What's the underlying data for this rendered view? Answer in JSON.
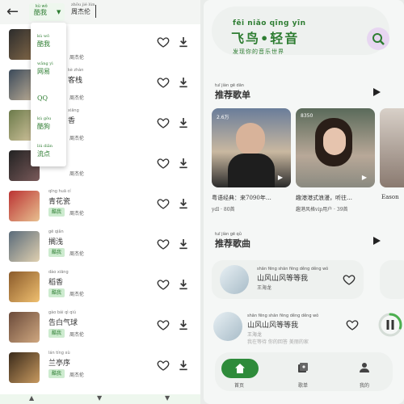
{
  "left": {
    "source_select": {
      "label": "酷我",
      "pinyin": "kù wǒ"
    },
    "search_value": {
      "text": "周杰伦",
      "pinyin": "zhōu jié lún"
    },
    "dropdown": [
      {
        "label": "酷我",
        "pinyin": "kù wǒ"
      },
      {
        "label": "网易",
        "pinyin": "wǎng yì"
      },
      {
        "label": "QQ",
        "pinyin": ""
      },
      {
        "label": "酷狗",
        "pinyin": "kù gǒu"
      },
      {
        "label": "流点",
        "pinyin": "liú diǎn"
      }
    ],
    "rows": [
      {
        "title": "",
        "pinyin": "",
        "badge": "",
        "artist": "周杰伦",
        "artist_pinyin": "zhōu jié lún"
      },
      {
        "title": "客栈",
        "pinyin": "kè zhàn",
        "badge": "",
        "artist": "周杰伦",
        "artist_pinyin": "zhōu jié lún"
      },
      {
        "title": "香",
        "pinyin": "xiāng",
        "badge": "",
        "artist": "周杰伦",
        "artist_pinyin": "zhōu jié lún"
      },
      {
        "title": "",
        "pinyin": "",
        "badge": "",
        "artist": "周杰伦",
        "artist_pinyin": "zhōu jié lún"
      },
      {
        "title": "青花瓷",
        "pinyin": "qīng huā cí",
        "badge": "酷我",
        "artist": "周杰伦",
        "artist_pinyin": "zhōu jié lún"
      },
      {
        "title": "搁浅",
        "pinyin": "gē qiǎn",
        "badge": "酷我",
        "artist": "周杰伦",
        "artist_pinyin": "zhōu jié lún"
      },
      {
        "title": "稻香",
        "pinyin": "dào xiāng",
        "badge": "酷我",
        "artist": "周杰伦",
        "artist_pinyin": "zhōu jié lún"
      },
      {
        "title": "告白气球",
        "pinyin": "gào bái qì qiú",
        "badge": "酷我",
        "artist": "周杰伦",
        "artist_pinyin": "zhōu jié lún"
      },
      {
        "title": "兰亭序",
        "pinyin": "lán tíng xù",
        "badge": "酷我",
        "artist": "周杰伦",
        "artist_pinyin": "zhōu jié lún"
      }
    ]
  },
  "right": {
    "logo": {
      "pinyin": "fēi niǎo qīng yīn",
      "text": "飞鸟•轻音",
      "sub": "发现你的音乐世界"
    },
    "playlist_section": {
      "title": "推荐歌单",
      "pinyin": "tuī jiàn gē dān"
    },
    "playlists": [
      {
        "name": "粤语经典：来7090年…",
        "author": "ydl · 80首",
        "count": "2.6万"
      },
      {
        "name": "趣港港式浪漫，听往…",
        "author": "趣港风格vip用户 · 39首",
        "count": "8350"
      },
      {
        "name": "Eason",
        "author": "",
        "count": ""
      }
    ],
    "song_section": {
      "title": "推荐歌曲",
      "pinyin": "tuī jiàn gē qǔ"
    },
    "songs": [
      {
        "title": "山风山风等等我",
        "pinyin": "shān fēng shān fēng děng děng wǒ",
        "artist": "王海龙"
      }
    ],
    "player": {
      "title": "山风山风等等我",
      "pinyin": "shān fēng shān fēng děng děng wǒ",
      "artist": "王海龙",
      "lyric": "我在等待 你的回答 美丽的家",
      "progress": 0.3
    },
    "nav": [
      {
        "label": "首页",
        "icon": "home-icon"
      },
      {
        "label": "歌单",
        "icon": "library-icon"
      },
      {
        "label": "我的",
        "icon": "person-icon"
      }
    ]
  }
}
